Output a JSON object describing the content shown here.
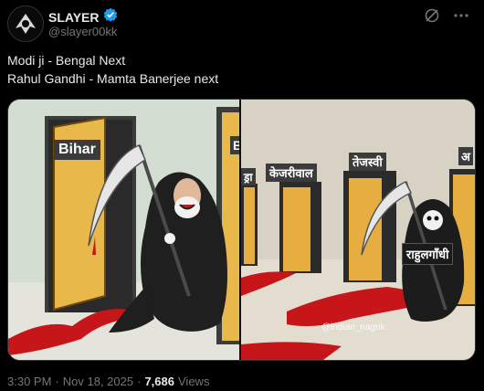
{
  "author": {
    "name": "SLAYER",
    "handle": "@slayer00kk",
    "verified": true
  },
  "tweet": {
    "line1": "Modi ji - Bengal Next",
    "line2": "Rahul Gandhi - Mamta Banerjee next"
  },
  "media": {
    "left_panel": {
      "door_label": "Bihar",
      "next_door_label": "B"
    },
    "right_panel": {
      "labels": [
        "ड्रा",
        "केजरीवाल",
        "तेजस्वी",
        "अ"
      ],
      "figure_label": "राहुलगाँधी",
      "watermark": "@indian_nagrik"
    }
  },
  "footer": {
    "time": "3:30 PM",
    "date": "Nov 18, 2025",
    "views_count": "7,686",
    "views_label": "Views"
  },
  "colors": {
    "background": "#000000",
    "text": "#e7e9ea",
    "muted": "#71767b",
    "verified": "#1d9bf0"
  }
}
